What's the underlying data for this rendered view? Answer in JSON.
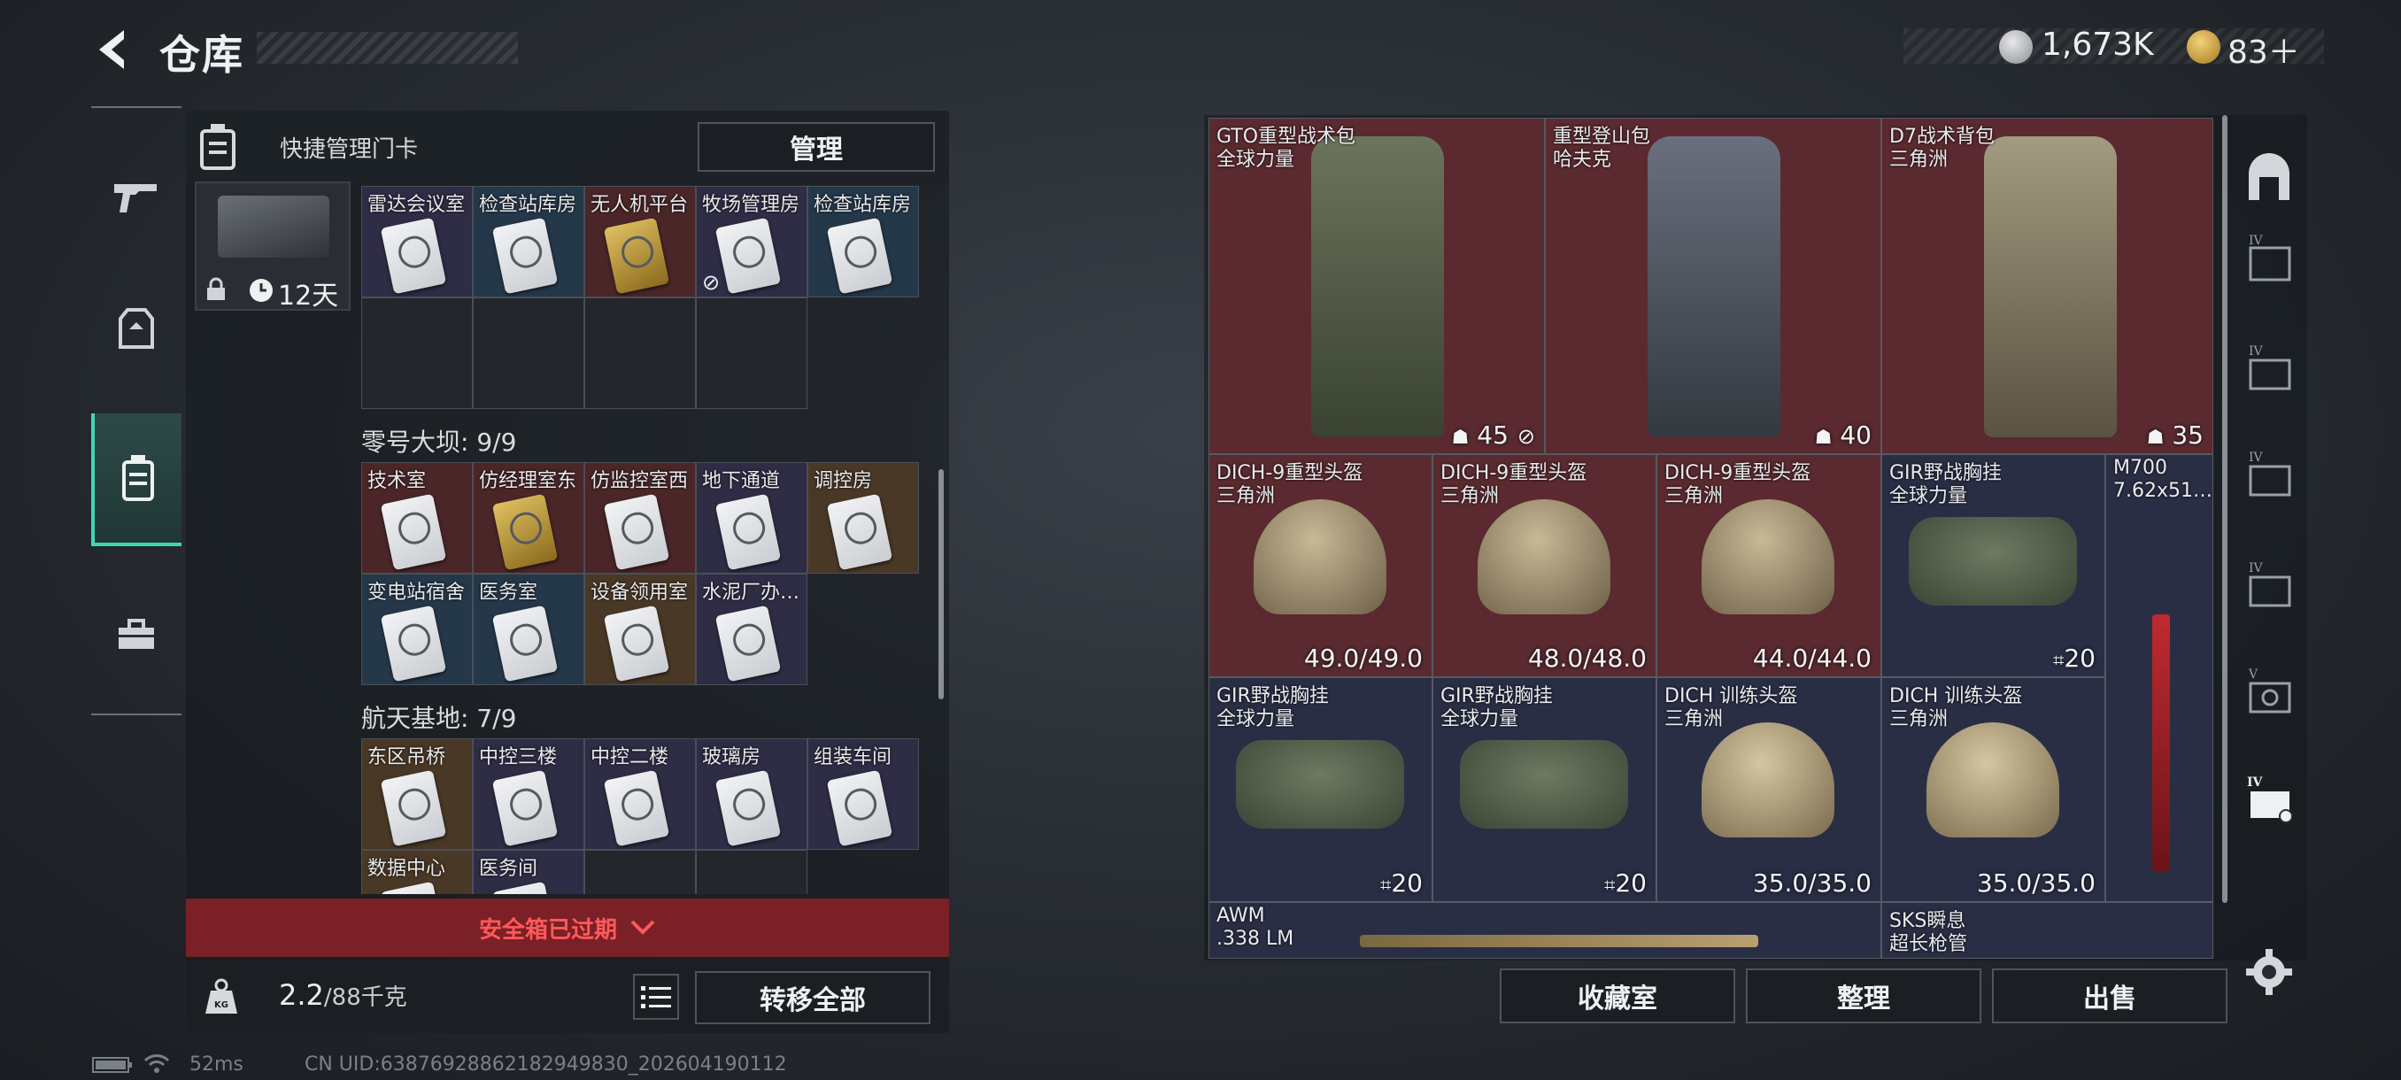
{
  "header": {
    "title": "仓库"
  },
  "currency": {
    "silver": "1,673K",
    "gold": "83＋"
  },
  "quick_manage": {
    "label": "快捷管理门卡",
    "button": "管理"
  },
  "card_box": {
    "duration": "12天"
  },
  "left_sections": [
    {
      "title": "",
      "cells": [
        {
          "label": "雷达会议室",
          "color": "purple",
          "gold": false
        },
        {
          "label": "检查站库房",
          "color": "blue",
          "gold": false
        },
        {
          "label": "无人机平台",
          "color": "red",
          "gold": true
        },
        {
          "label": "牧场管理房",
          "color": "purple",
          "gold": false,
          "badge": true
        },
        {
          "label": "检查站库房",
          "color": "blue",
          "gold": false
        },
        {
          "label": "",
          "color": "empty"
        },
        {
          "label": "",
          "color": "empty"
        },
        {
          "label": "",
          "color": "empty"
        },
        {
          "label": "",
          "color": "empty"
        }
      ]
    },
    {
      "title": "零号大坝: 9/9",
      "cells": [
        {
          "label": "技术室",
          "color": "red",
          "gold": false
        },
        {
          "label": "仿经理室东",
          "color": "red",
          "gold": true
        },
        {
          "label": "仿监控室西",
          "color": "red",
          "gold": false
        },
        {
          "label": "地下通道",
          "color": "purple",
          "gold": false
        },
        {
          "label": "调控房",
          "color": "brown",
          "gold": false
        },
        {
          "label": "变电站宿舍",
          "color": "blue",
          "gold": false
        },
        {
          "label": "医务室",
          "color": "blue",
          "gold": false
        },
        {
          "label": "设备领用室",
          "color": "brown",
          "gold": false
        },
        {
          "label": "水泥厂办…",
          "color": "purple",
          "gold": false
        }
      ]
    },
    {
      "title": "航天基地: 7/9",
      "cells": [
        {
          "label": "东区吊桥",
          "color": "brown",
          "gold": false
        },
        {
          "label": "中控三楼",
          "color": "purple",
          "gold": false
        },
        {
          "label": "中控二楼",
          "color": "purple",
          "gold": false
        },
        {
          "label": "玻璃房",
          "color": "purple",
          "gold": false
        },
        {
          "label": "组装车间",
          "color": "purple",
          "gold": false
        },
        {
          "label": "数据中心",
          "color": "brown",
          "gold": false
        },
        {
          "label": "医务间",
          "color": "purple",
          "gold": false
        },
        {
          "label": "",
          "color": "empty"
        },
        {
          "label": "",
          "color": "empty"
        }
      ]
    }
  ],
  "safe_box": {
    "expired": "安全箱已过期"
  },
  "weight": {
    "current": "2.2",
    "max": "/88千克",
    "transfer_all": "转移全部"
  },
  "items": {
    "backpacks": [
      {
        "name": "GTO重型战术包",
        "source": "全球力量",
        "count": "45",
        "color": "#5d6650"
      },
      {
        "name": "重型登山包",
        "source": "哈夫克",
        "count": "40",
        "color": "#5c6170"
      },
      {
        "name": "D7战术背包",
        "source": "三角洲",
        "count": "35",
        "color": "#8a8068"
      }
    ],
    "row2": [
      {
        "name": "DICH-9重型头盔",
        "source": "三角洲",
        "value": "49.0/49.0"
      },
      {
        "name": "DICH-9重型头盔",
        "source": "三角洲",
        "value": "48.0/48.0"
      },
      {
        "name": "DICH-9重型头盔",
        "source": "三角洲",
        "value": "44.0/44.0"
      },
      {
        "name": "GIR野战胸挂",
        "source": "全球力量",
        "value": "20"
      }
    ],
    "row3": [
      {
        "name": "GIR野战胸挂",
        "source": "全球力量",
        "value": "20"
      },
      {
        "name": "GIR野战胸挂",
        "source": "全球力量",
        "value": "20"
      },
      {
        "name": "DICH 训练头盔",
        "source": "三角洲",
        "value": "35.0/35.0"
      },
      {
        "name": "DICH 训练头盔",
        "source": "三角洲",
        "value": "35.0/35.0"
      }
    ],
    "m700": {
      "name": "M700",
      "caliber": "7.62x51…"
    },
    "awm": {
      "name": "AWM",
      "caliber": ".338 LM"
    },
    "sks": {
      "name": "SKS瞬息",
      "caliber": "超长枪管"
    }
  },
  "actions": {
    "collection": "收藏室",
    "sort": "整理",
    "sell": "出售"
  },
  "footer": {
    "ping": "52ms",
    "uid": "CN UID:638769288621829498​30_202604190112"
  }
}
